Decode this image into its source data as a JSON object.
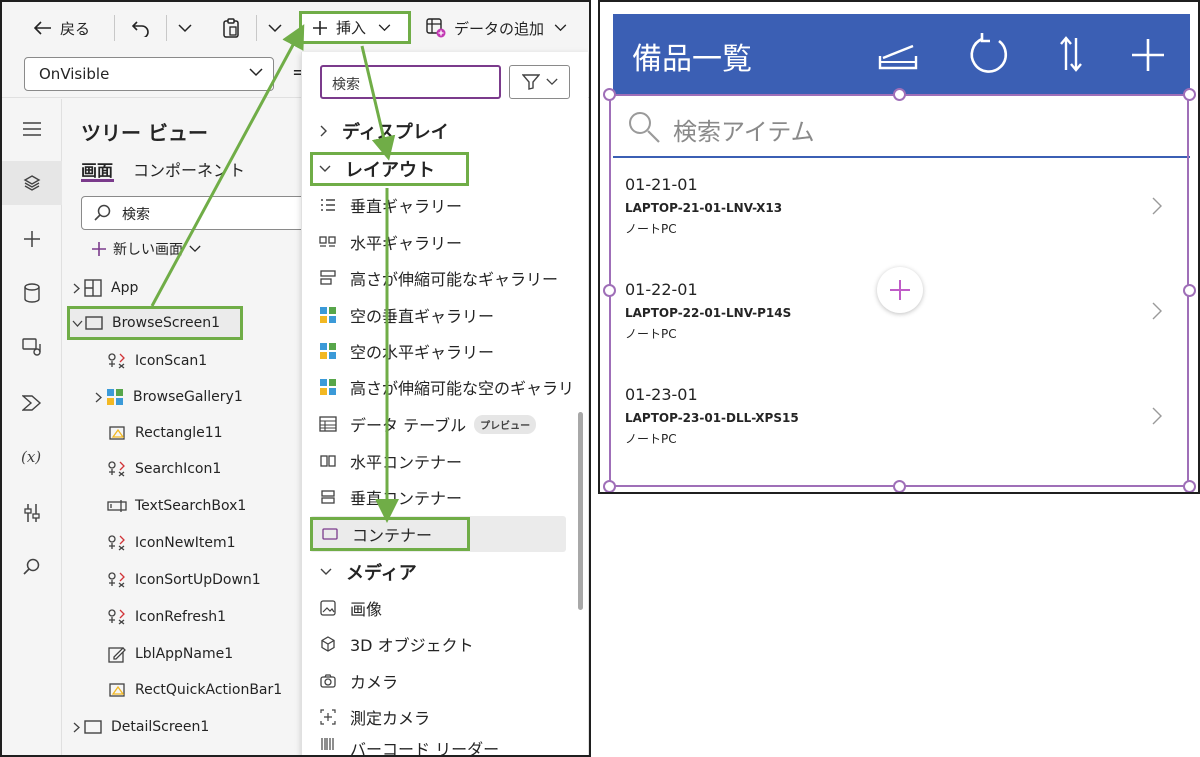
{
  "toolbar": {
    "back_label": "戻る",
    "undo_icon": "undo-icon",
    "insert_label": "挿入",
    "add_data_label": "データの追加"
  },
  "formula_bar": {
    "property_value": "OnVisible",
    "fx_symbol": "="
  },
  "left_rail": [
    "hamburger-icon",
    "layers-icon",
    "plus-icon",
    "database-icon",
    "media-icon",
    "power-automate-icon",
    "variables-icon",
    "tools-icon",
    "search-icon"
  ],
  "tree_view": {
    "title": "ツリー ビュー",
    "tab_screens": "画面",
    "tab_components": "コンポーネント",
    "search_placeholder": "検索",
    "new_screen_label": "新しい画面",
    "nodes": [
      {
        "label": "App"
      },
      {
        "label": "BrowseScreen1"
      },
      {
        "label": "IconScan1"
      },
      {
        "label": "BrowseGallery1"
      },
      {
        "label": "Rectangle11"
      },
      {
        "label": "SearchIcon1"
      },
      {
        "label": "TextSearchBox1"
      },
      {
        "label": "IconNewItem1"
      },
      {
        "label": "IconSortUpDown1"
      },
      {
        "label": "IconRefresh1"
      },
      {
        "label": "LblAppName1"
      },
      {
        "label": "RectQuickActionBar1"
      },
      {
        "label": "DetailScreen1"
      }
    ]
  },
  "insert_panel": {
    "search_value": "検索",
    "categories": {
      "display": "ディスプレイ",
      "layout": "レイアウト",
      "media": "メディア"
    },
    "layout_items": [
      {
        "label": "垂直ギャラリー"
      },
      {
        "label": "水平ギャラリー"
      },
      {
        "label": "高さが伸縮可能なギャラリー"
      },
      {
        "label": "空の垂直ギャラリー"
      },
      {
        "label": "空の水平ギャラリー"
      },
      {
        "label": "高さが伸縮可能な空のギャラリ"
      },
      {
        "label": "データ テーブル",
        "badge": "プレビュー"
      },
      {
        "label": "水平コンテナー"
      },
      {
        "label": "垂直コンテナー"
      },
      {
        "label": "コンテナー"
      }
    ],
    "media_items": [
      {
        "label": "画像"
      },
      {
        "label": "3D オブジェクト"
      },
      {
        "label": "カメラ"
      },
      {
        "label": "測定カメラ"
      },
      {
        "label": "バーコード リーダー"
      }
    ]
  },
  "app_preview": {
    "title": "備品一覧",
    "search_placeholder": "検索アイテム",
    "header_icons": [
      "scan-icon",
      "refresh-icon",
      "sort-icon",
      "add-icon"
    ],
    "accent_color": "#3b5fb4",
    "selection_color": "#9f6fb8",
    "items": [
      {
        "id": "01-21-01",
        "name": "LAPTOP-21-01-LNV-X13",
        "category": "ノートPC"
      },
      {
        "id": "01-22-01",
        "name": "LAPTOP-22-01-LNV-P14S",
        "category": "ノートPC"
      },
      {
        "id": "01-23-01",
        "name": "LAPTOP-23-01-DLL-XPS15",
        "category": "ノートPC"
      }
    ]
  },
  "annotation_color": "#70ad47"
}
